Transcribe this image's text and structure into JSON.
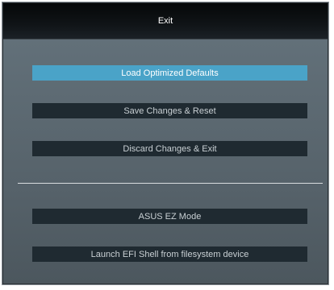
{
  "dialog": {
    "title": "Exit",
    "items": [
      {
        "label": "Load Optimized Defaults",
        "selected": true
      },
      {
        "label": "Save Changes & Reset",
        "selected": false
      },
      {
        "label": "Discard Changes & Exit",
        "selected": false
      },
      {
        "label": "ASUS EZ Mode",
        "selected": false
      },
      {
        "label": "Launch EFI Shell from filesystem device",
        "selected": false
      }
    ]
  },
  "colors": {
    "selected_accent": "#4aa3c8",
    "button_bg": "#1f2a31",
    "panel_bg": "#5c6870",
    "title_bg": "#0c1013"
  }
}
